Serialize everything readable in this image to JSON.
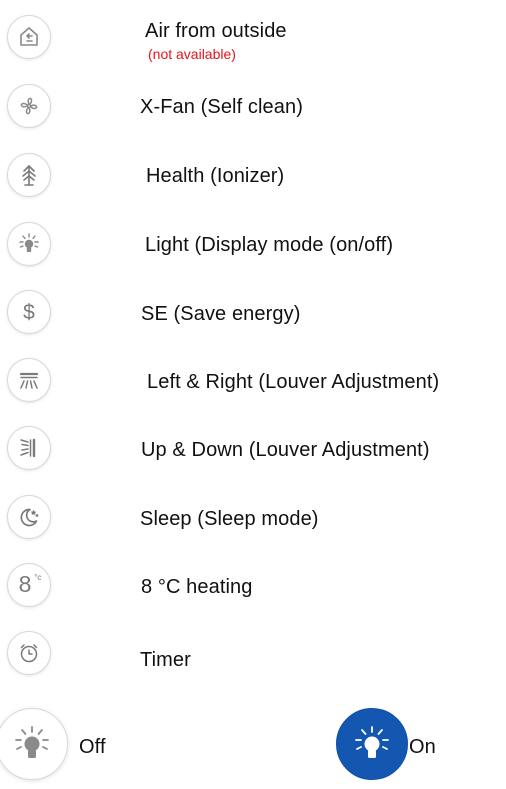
{
  "colors": {
    "icon_gray": "#8a8a8a",
    "note_red": "#e8131a",
    "on_blue": "#1457b0"
  },
  "features": [
    {
      "icon": "house-arrow-icon",
      "label": "Air from outside",
      "note": "(not available)"
    },
    {
      "icon": "fan-icon",
      "label": "X-Fan (Self clean)"
    },
    {
      "icon": "tree-icon",
      "label": "Health (Ionizer)"
    },
    {
      "icon": "light-bulb-icon",
      "label": "Light (Display mode (on/off)"
    },
    {
      "icon": "dollar-icon",
      "label": "SE (Save energy)",
      "glyph": "$"
    },
    {
      "icon": "louver-left-right-icon",
      "label": "Left & Right (Louver Adjustment)"
    },
    {
      "icon": "louver-up-down-icon",
      "label": "Up & Down (Louver Adjustment)"
    },
    {
      "icon": "moon-stars-icon",
      "label": "Sleep (Sleep mode)"
    },
    {
      "icon": "eight-degrees-icon",
      "label": "8 °C heating",
      "glyph": "8",
      "glyph_sup": "°c"
    },
    {
      "icon": "alarm-clock-icon",
      "label": "Timer"
    }
  ],
  "light_states": {
    "off": {
      "icon": "light-bulb-off-icon",
      "label": "Off"
    },
    "on": {
      "icon": "light-bulb-on-icon",
      "label": "On"
    }
  }
}
